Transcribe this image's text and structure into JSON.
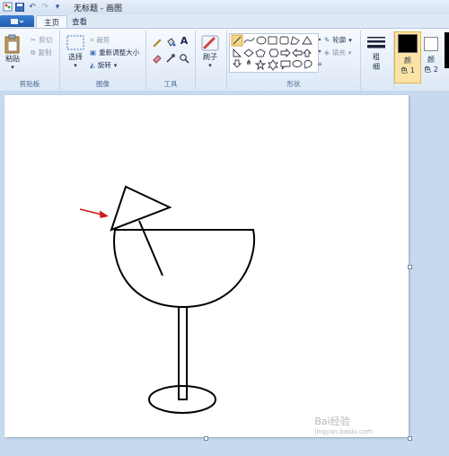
{
  "window": {
    "title": "无标题 - 画图"
  },
  "tabs": [
    {
      "label": "主页",
      "active": true
    },
    {
      "label": "查看",
      "active": false
    }
  ],
  "ribbon": {
    "clipboard": {
      "paste": "粘贴",
      "cut": "剪切",
      "copy": "复制",
      "group_label": "剪贴板"
    },
    "image": {
      "select": "选择",
      "crop": "裁剪",
      "resize": "重新调整大小",
      "rotate": "旋转",
      "group_label": "图像"
    },
    "tools": {
      "group_label": "工具",
      "text_tool": "A"
    },
    "brushes": {
      "label": "刷子"
    },
    "shapes": {
      "outline": "轮廓",
      "fill": "填充",
      "group_label": "形状"
    },
    "size": {
      "label_line1": "粗",
      "label_line2": "细"
    },
    "colors": {
      "color1_line1": "颜",
      "color1_line2": "色 1",
      "color2_line1": "颜",
      "color2_line2": "色 2",
      "color1_value": "#000000",
      "color2_value": "#ffffff"
    }
  },
  "watermark": {
    "text": "Bai经验",
    "sub": "jingyan.baidu.com"
  },
  "colors": {
    "accent": "#1f5cae",
    "arrow": "#d01818",
    "workspace": "#c7d9ee"
  }
}
